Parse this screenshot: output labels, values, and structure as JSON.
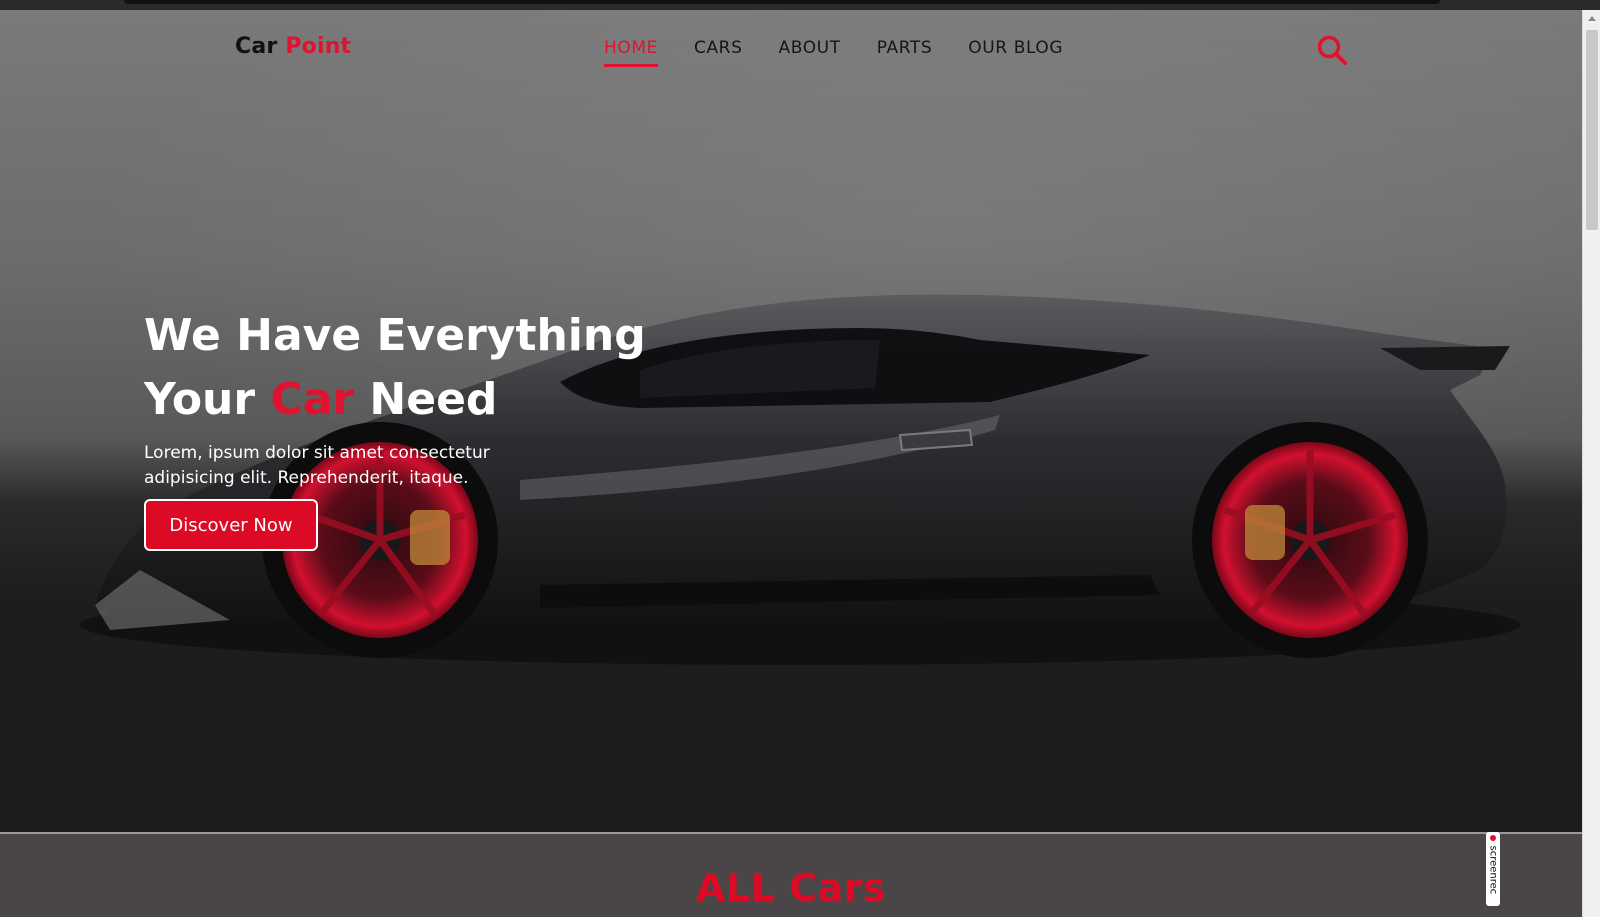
{
  "brand": {
    "part1": "Car",
    "part2": "Point"
  },
  "nav": {
    "items": [
      {
        "label": "HOME",
        "active": true
      },
      {
        "label": "CARS",
        "active": false
      },
      {
        "label": "ABOUT",
        "active": false
      },
      {
        "label": "PARTS",
        "active": false
      },
      {
        "label": "OUR BLOG",
        "active": false
      }
    ],
    "search_icon": "search-icon"
  },
  "hero": {
    "headline_line1": "We Have Everything",
    "headline_line2_a": "Your",
    "headline_line2_b": "Car",
    "headline_line2_c": "Need",
    "subtitle": "Lorem, ipsum dolor sit amet consectetur adipisicing elit. Reprehenderit, itaque.",
    "cta_label": "Discover Now"
  },
  "section": {
    "title": "ALL Cars"
  },
  "overlay": {
    "screenrec_label": "screenrec"
  },
  "colors": {
    "accent": "#dd0a26",
    "text_dark": "#151515",
    "bg_section": "#4a4648"
  }
}
